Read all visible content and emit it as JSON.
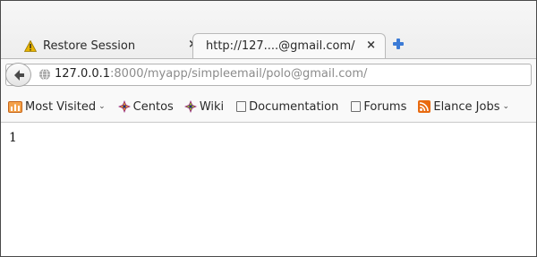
{
  "tabs": [
    {
      "label": "Restore Session",
      "icon": "warning-icon",
      "close": "×",
      "active": false
    },
    {
      "label": "http://127....@gmail.com/",
      "close": "×",
      "active": true
    }
  ],
  "new_tab_icon": "plus-icon",
  "address": {
    "host": "127.0.0.1",
    "rest": ":8000/myapp/simpleemail/polo@gmail.com/"
  },
  "bookmarks": [
    {
      "label": "Most Visited",
      "icon": "most-visited-icon",
      "dropdown": true
    },
    {
      "label": "Centos",
      "icon": "centos-icon",
      "dropdown": false
    },
    {
      "label": "Wiki",
      "icon": "centos-icon",
      "dropdown": false
    },
    {
      "label": "Documentation",
      "icon": "page-icon",
      "dropdown": false
    },
    {
      "label": "Forums",
      "icon": "page-icon",
      "dropdown": false
    },
    {
      "label": "Elance Jobs",
      "icon": "rss-icon",
      "dropdown": true
    }
  ],
  "page": {
    "output": "1"
  },
  "colors": {
    "warning": "#e8b400",
    "new_tab": "#3c7bd6",
    "rss": "#e86a10"
  }
}
